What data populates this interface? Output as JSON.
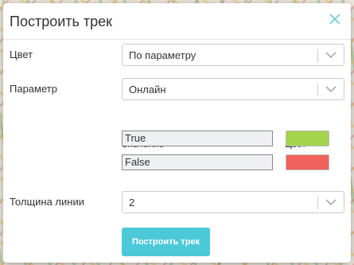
{
  "dialog": {
    "title": "Построить трек",
    "close_icon": "close-icon"
  },
  "form": {
    "color_label": "Цвет",
    "color_value": "По параметру",
    "param_label": "Параметр",
    "param_value": "Онлайн",
    "value_header": "Значение",
    "color_header": "Цвет",
    "rows": [
      {
        "value": "True",
        "color": "#a3d44c"
      },
      {
        "value": "False",
        "color": "#f0625b"
      }
    ],
    "width_label": "Толщина линии",
    "width_value": "2",
    "submit_label": "Построить трек"
  },
  "colors": {
    "accent": "#4cc9d9",
    "close": "#6fd0dc"
  }
}
